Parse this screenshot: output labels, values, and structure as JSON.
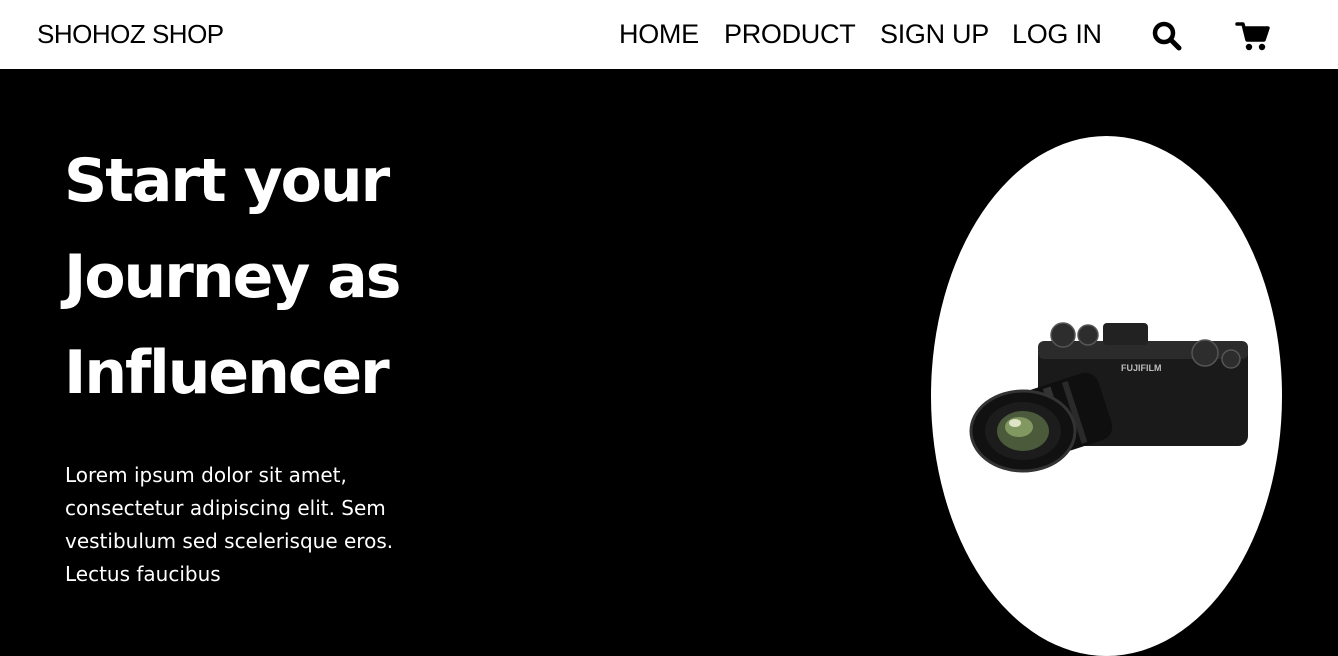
{
  "brand": "SHOHOZ SHOP",
  "nav": {
    "home": "HOME",
    "product": "PRODUCT",
    "signup": "SIGN UP",
    "login": "LOG IN"
  },
  "icons": {
    "search": "search-icon",
    "cart": "cart-icon"
  },
  "hero": {
    "headline_line1": "Start your",
    "headline_line2": "Journey as",
    "headline_line3": "Influencer",
    "description": "Lorem ipsum dolor sit amet, consectetur adipiscing elit. Sem vestibulum sed scelerisque eros. Lectus faucibus",
    "camera_brand_text": "FUJIFILM"
  },
  "colors": {
    "nav_bg": "#ffffff",
    "hero_bg": "#000000",
    "text_primary": "#ffffff",
    "text_nav": "#000000"
  }
}
